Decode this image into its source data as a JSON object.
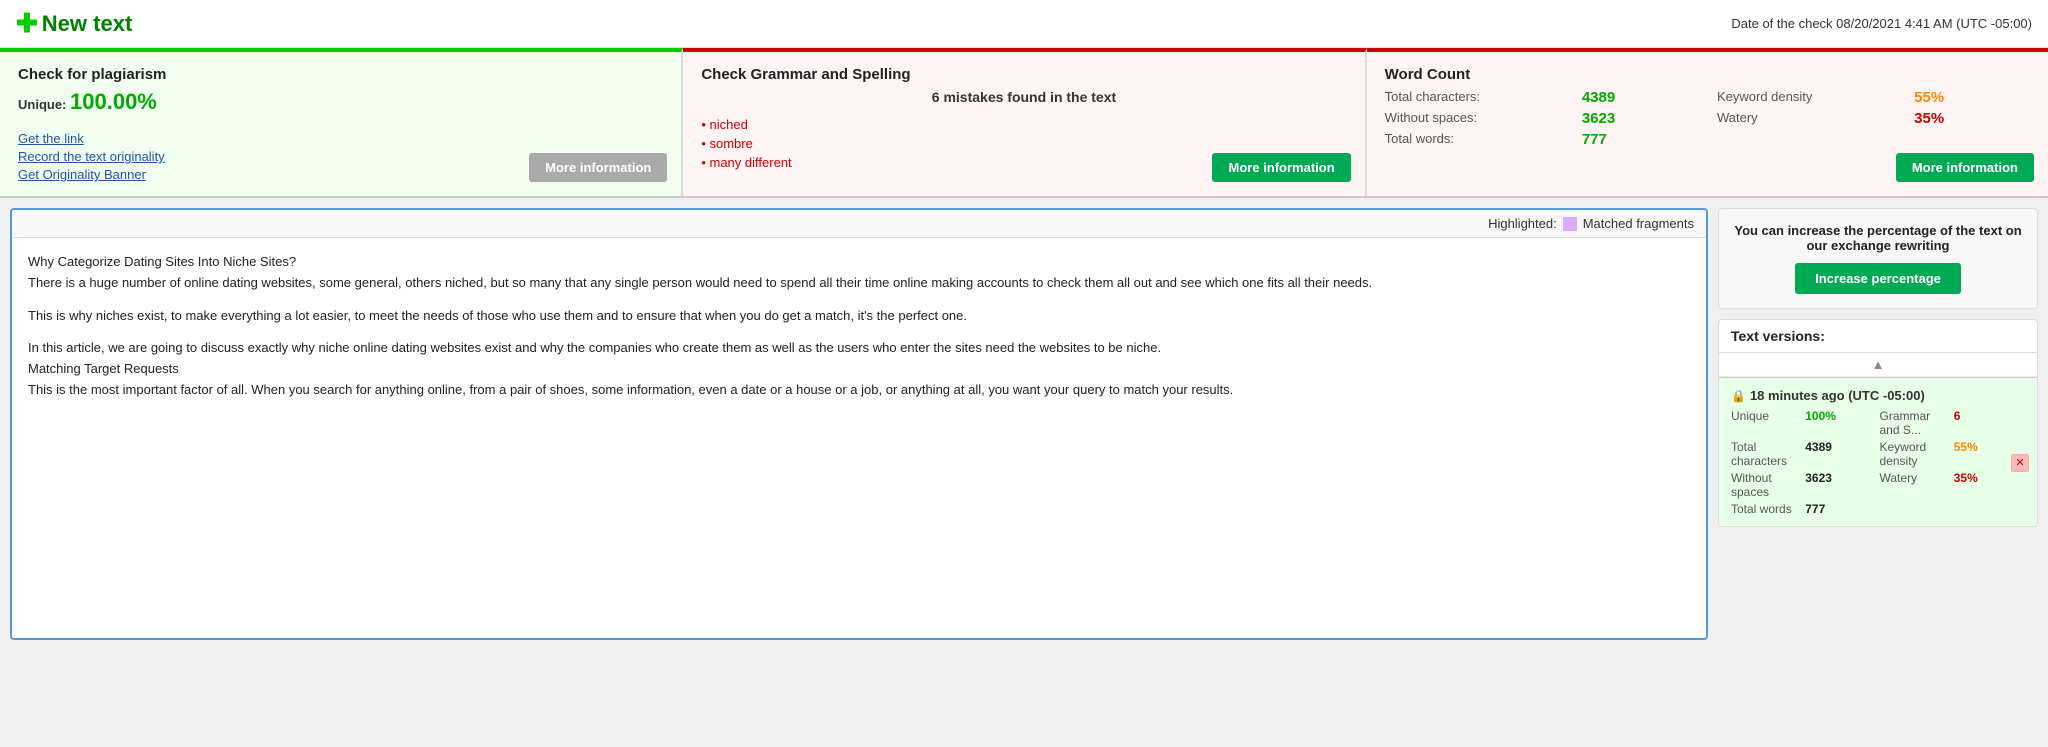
{
  "topbar": {
    "new_text_label": "New text",
    "date_label": "Date of the check 08/20/2021 4:41 AM (UTC -05:00)"
  },
  "plagiarism_card": {
    "title": "Check for plagiarism",
    "unique_label": "Unique:",
    "unique_value": "100.00%",
    "link_get": "Get the link",
    "link_record": "Record the text originality",
    "link_banner": "Get Originality Banner",
    "more_info": "More information"
  },
  "grammar_card": {
    "title": "Check Grammar and Spelling",
    "subtitle": "6 mistakes found in the text",
    "mistakes": [
      "niched",
      "sombre",
      "many different"
    ],
    "more_info": "More information"
  },
  "wordcount_card": {
    "title": "Word Count",
    "total_chars_label": "Total characters:",
    "total_chars_val": "4389",
    "without_spaces_label": "Without spaces:",
    "without_spaces_val": "3623",
    "total_words_label": "Total words:",
    "total_words_val": "777",
    "keyword_density_label": "Keyword density",
    "keyword_density_val": "55%",
    "watery_label": "Watery",
    "watery_val": "35%",
    "more_info": "More information"
  },
  "text_panel": {
    "highlighted_label": "Highlighted:",
    "matched_label": "Matched fragments",
    "content_paragraphs": [
      "Why Categorize Dating Sites Into Niche Sites?\nThere is a huge number of online dating websites, some general, others niched, but so many that any single person would need to spend all their time online making accounts to check them all out and see which one fits all their needs.",
      "This is why niches exist, to make everything a lot easier, to meet the needs of those who use them and to ensure that when you do get a match, it's the perfect one.",
      "In this article, we are going to discuss exactly why niche online dating websites exist and why the companies who create them as well as the users who enter the sites need the websites to be niche.\nMatching Target Requests\nThis is the most important factor of all. When you search for anything online, from a pair of shoes, some information, even a date or a house or a job, or anything at all, you want your query to match your results."
    ]
  },
  "right_panel": {
    "increase_text": "You can increase the percentage of the text on our exchange rewriting",
    "increase_btn": "Increase percentage",
    "versions_title": "Text versions:",
    "version": {
      "time": "18 minutes ago (UTC -05:00)",
      "unique_label": "Unique",
      "unique_val": "100%",
      "grammar_label": "Grammar and S...",
      "grammar_val": "6",
      "chars_label": "Total characters",
      "chars_val": "4389",
      "keyword_label": "Keyword density",
      "keyword_val": "55%",
      "spaces_label": "Without spaces",
      "spaces_val": "3623",
      "watery_label": "Watery",
      "watery_val": "35%",
      "words_label": "Total words",
      "words_val": "777"
    }
  }
}
